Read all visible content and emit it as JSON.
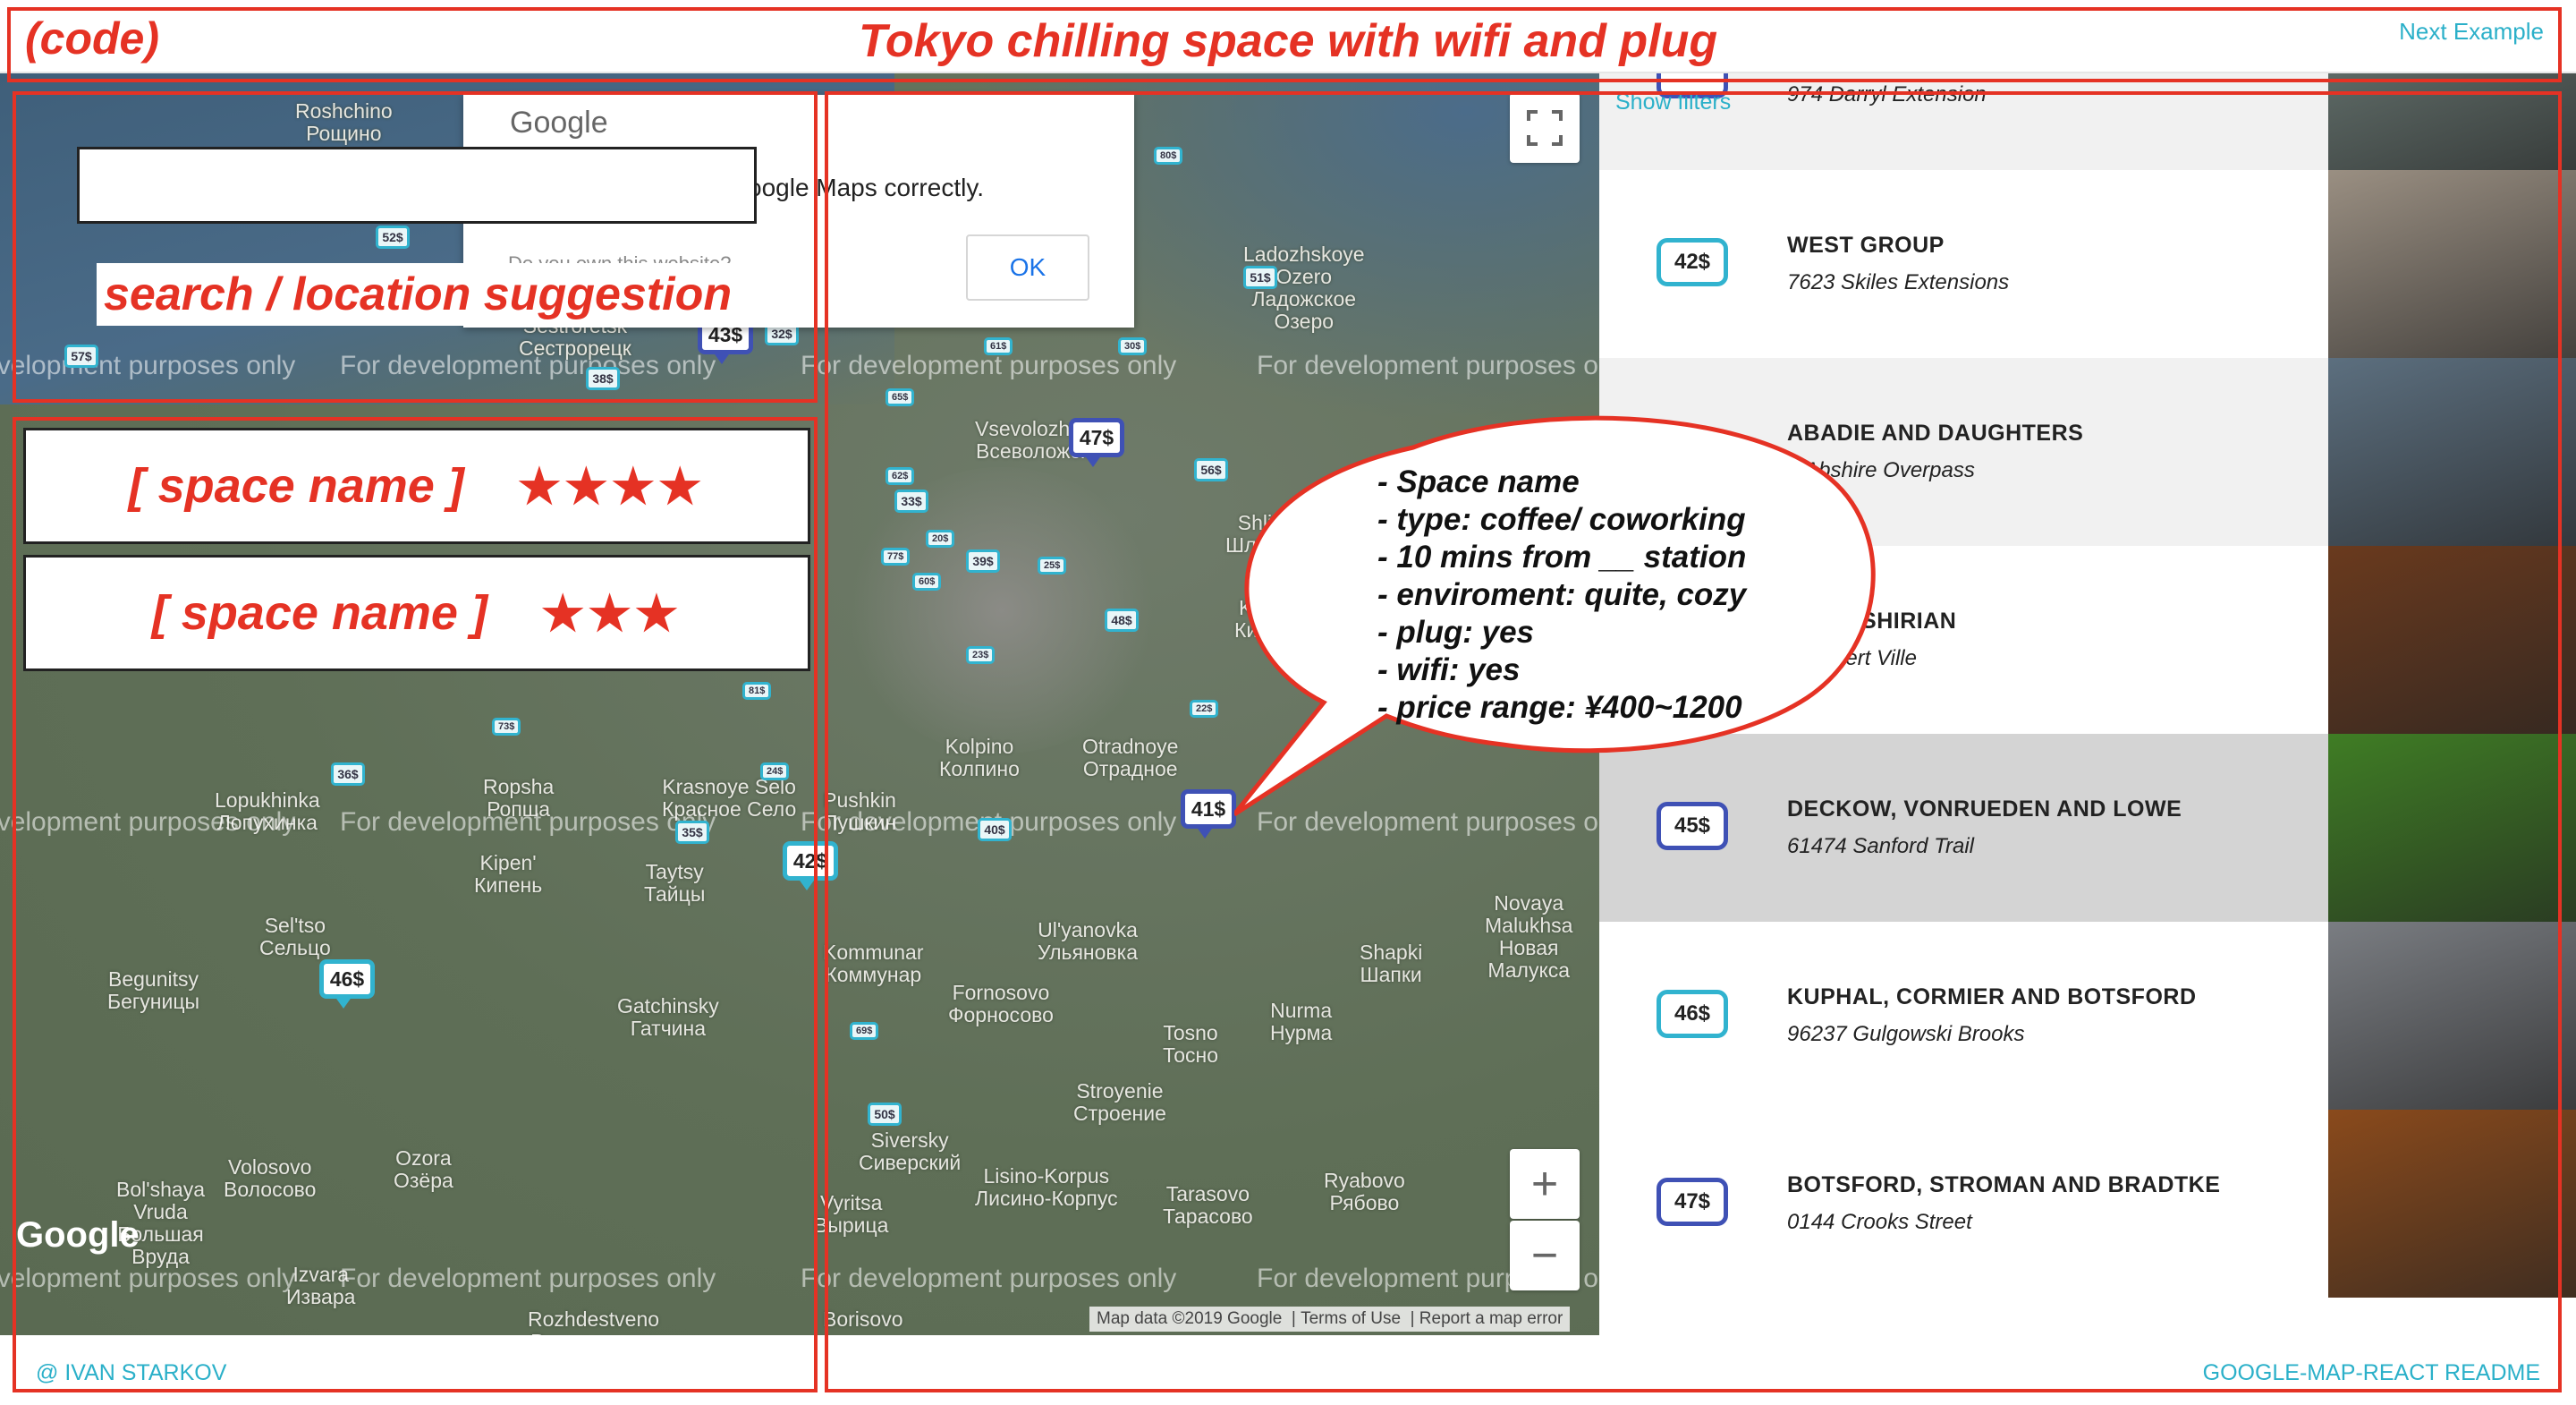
{
  "header": {
    "code_label": "(code)",
    "title": "Tokyo chilling space with wifi and plug",
    "next_link": "Next Example"
  },
  "map": {
    "google_dialog": {
      "logo": "Google",
      "message": "oogle Maps correctly.",
      "question": "Do you own this website?",
      "ok_label": "OK"
    },
    "watermark": "For development purposes only",
    "google_logo": "Google",
    "attribution": {
      "data": "Map data ©2019 Google",
      "terms": "Terms of Use",
      "report": "Report a map error"
    },
    "zoom_in": "+",
    "zoom_out": "−",
    "places": [
      "Roshchino\nРощино",
      "Ladozhskoye\nOzero\nЛадожское\nОзеро",
      "Sestroretsk\nСестрорецк",
      "Vsevolozhsk\nВсеволожск",
      "Shlisselburg\nШлиссельбург",
      "Kirovsk\nКировск",
      "Kolpino\nКолпино",
      "Otradnoye\nОтрадное",
      "Pushkin\nПушкин",
      "Lopukhinka\nЛопухинка",
      "Ropsha\nРопша",
      "Krasnoye Selo\nКрасное Село",
      "Kipen'\nКипень",
      "Taytsy\nТайцы",
      "Sel'tso\nСельцо",
      "Begunitsy\nБегуницы",
      "Gatchinsky\nГатчина",
      "Kommunar\nКоммунар",
      "Ul'yanovka\nУльяновка",
      "Fornosovo\nФорносово",
      "Tosno\nТосно",
      "Nurma\nНурма",
      "Novaya\nMalukhsa\nНовая\nМалукса",
      "Shapki\nШапки",
      "Stroyenie\nСтроение",
      "Lisino-Korpus\nЛисино-Корпус",
      "Tarasovo\nТарасово",
      "Ryabovo\nРябово",
      "Volosovo\nВолосово",
      "Ozora\nОзёра",
      "Bol'shaya\nVruda\nБольшая\nВруда",
      "Izvara\nИзвара",
      "Rozhdestveno\nРождествено",
      "Borisovo",
      "Siversky\nСиверский",
      "Vyritsa\nВырица"
    ],
    "markers": [
      {
        "label": "43$",
        "style": "dark"
      },
      {
        "label": "47$",
        "style": "dark"
      },
      {
        "label": "41$",
        "style": "dark"
      },
      {
        "label": "42$",
        "style": "light"
      },
      {
        "label": "46$",
        "style": "light"
      }
    ],
    "mini_markers": [
      "52$",
      "57$",
      "32$",
      "38$",
      "51$",
      "33$",
      "56$",
      "39$",
      "48$",
      "36$",
      "35$",
      "40$",
      "50$",
      "80$",
      "61$",
      "30$",
      "62$",
      "65$",
      "20$",
      "77$",
      "60$",
      "23$",
      "22$",
      "81$",
      "24$",
      "73$",
      "69$",
      "25$"
    ]
  },
  "annotations": {
    "search_caption": "search / location suggestion",
    "space_cards": [
      {
        "name": "[ space name ]",
        "stars": "★★★★"
      },
      {
        "name": "[ space name ]",
        "stars": "★★★"
      }
    ],
    "bubble_lines": [
      "- Space name",
      "- type: coffee/ coworking",
      "- 10 mins from __ station",
      "- enviroment: quite, cozy",
      "- plug: yes",
      "- wifi: yes",
      "- price range: ¥400~1200"
    ]
  },
  "list": {
    "show_filters": "Show filters",
    "rows": [
      {
        "price": "",
        "name": "",
        "address": "974 Darryl Extension",
        "style": "dark",
        "thumb": "#6f7f7a",
        "bg": "#f1f1f1"
      },
      {
        "price": "42$",
        "name": "WEST GROUP",
        "address": "7623 Skiles Extensions",
        "style": "light",
        "thumb": "#9a8f82",
        "bg": "#ffffff"
      },
      {
        "price": "",
        "name": "ABADIE AND DAUGHTERS",
        "address": "4 Abshire Overpass",
        "style": "light",
        "thumb": "#5c6f7f",
        "bg": "#f1f1f1"
      },
      {
        "price": "",
        "name": "HA-BASHIRIAN",
        "address": "8 Mayert Ville",
        "style": "light",
        "thumb": "#6a3a1e",
        "bg": "#ffffff"
      },
      {
        "price": "45$",
        "name": "DECKOW, VONRUEDEN AND LOWE",
        "address": "61474 Sanford Trail",
        "style": "dark",
        "thumb": "#3f7d24",
        "bg": "#d4d4d4"
      },
      {
        "price": "46$",
        "name": "KUPHAL, CORMIER AND BOTSFORD",
        "address": "96237 Gulgowski Brooks",
        "style": "light",
        "thumb": "#7a7d82",
        "bg": "#ffffff"
      },
      {
        "price": "47$",
        "name": "BOTSFORD, STROMAN AND BRADTKE",
        "address": "0144 Crooks Street",
        "style": "dark",
        "thumb": "#8a4a1c",
        "bg": "#ffffff"
      }
    ]
  },
  "footer": {
    "left": "@ IVAN STARKOV",
    "right": "GOOGLE-MAP-REACT README"
  }
}
